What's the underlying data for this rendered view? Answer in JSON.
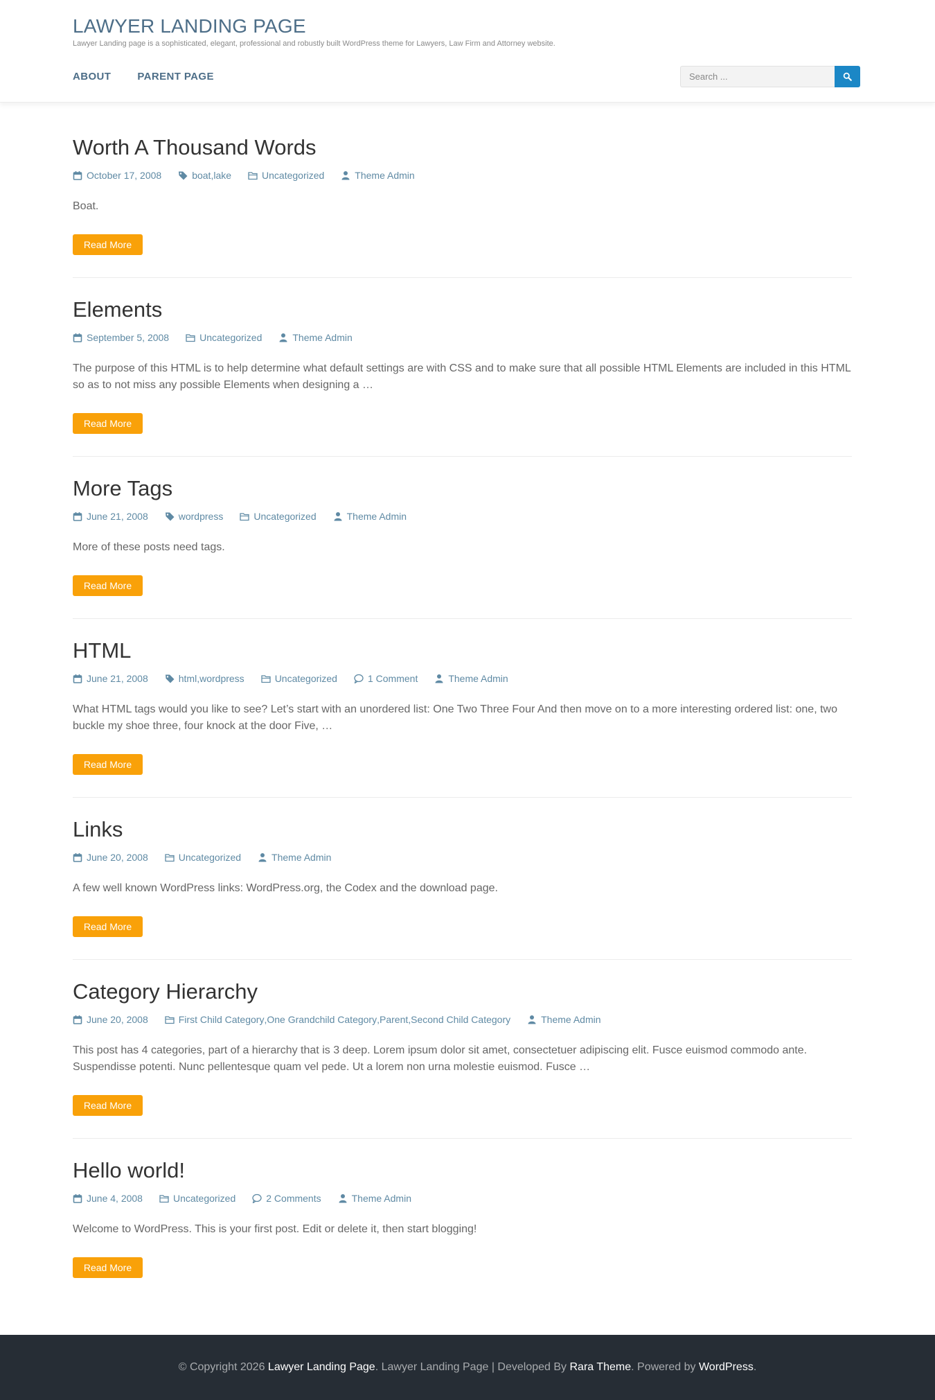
{
  "header": {
    "site_title": "LAWYER LANDING PAGE",
    "tagline": "Lawyer Landing page is a sophisticated, elegant, professional and robustly built WordPress theme for Lawyers, Law Firm and Attorney website.",
    "nav": [
      "ABOUT",
      "PARENT PAGE"
    ],
    "search_placeholder": "Search ..."
  },
  "posts": [
    {
      "title": "Worth A Thousand Words",
      "date": "October 17, 2008",
      "tags": [
        "boat",
        "lake"
      ],
      "categories": [
        "Uncategorized"
      ],
      "comments": "",
      "author": "Theme Admin",
      "excerpt": "Boat.",
      "read_more": "Read More"
    },
    {
      "title": "Elements",
      "date": "September 5, 2008",
      "tags": [],
      "categories": [
        "Uncategorized"
      ],
      "comments": "",
      "author": "Theme Admin",
      "excerpt": "The purpose of this HTML is to help determine what default settings are with CSS and to make sure that all possible HTML Elements are included in this HTML so as to not miss any possible Elements when designing a …",
      "read_more": "Read More"
    },
    {
      "title": "More Tags",
      "date": "June 21, 2008",
      "tags": [
        "wordpress"
      ],
      "categories": [
        "Uncategorized"
      ],
      "comments": "",
      "author": "Theme Admin",
      "excerpt": "More of these posts need tags.",
      "read_more": "Read More"
    },
    {
      "title": "HTML",
      "date": "June 21, 2008",
      "tags": [
        "html",
        "wordpress"
      ],
      "categories": [
        "Uncategorized"
      ],
      "comments": "1 Comment",
      "author": "Theme Admin",
      "excerpt": "What HTML tags would you like to see? Let’s start with an unordered list: One Two Three Four And then move on to a more interesting ordered list: one, two buckle my shoe three, four knock at the door Five, …",
      "read_more": "Read More"
    },
    {
      "title": "Links",
      "date": "June 20, 2008",
      "tags": [],
      "categories": [
        "Uncategorized"
      ],
      "comments": "",
      "author": "Theme Admin",
      "excerpt": "A few well known WordPress links: WordPress.org, the Codex and the download page.",
      "read_more": "Read More"
    },
    {
      "title": "Category Hierarchy",
      "date": "June 20, 2008",
      "tags": [],
      "categories": [
        "First Child Category",
        "One Grandchild Category",
        "Parent",
        "Second Child Category"
      ],
      "comments": "",
      "author": "Theme Admin",
      "excerpt": "This post has 4 categories, part of a hierarchy that is 3 deep. Lorem ipsum dolor sit amet, consectetuer adipiscing elit. Fusce euismod commodo ante. Suspendisse potenti. Nunc pellentesque quam vel pede. Ut a lorem non urna molestie euismod. Fusce …",
      "read_more": "Read More"
    },
    {
      "title": "Hello world!",
      "date": "June 4, 2008",
      "tags": [],
      "categories": [
        "Uncategorized"
      ],
      "comments": "2 Comments",
      "author": "Theme Admin",
      "excerpt": "Welcome to WordPress. This is your first post. Edit or delete it, then start blogging!",
      "read_more": "Read More"
    }
  ],
  "footer": {
    "copyright": "© Copyright 2026",
    "site_link": "Lawyer Landing Page",
    "developed_text": ". Lawyer Landing Page | Developed By",
    "developer_link": "Rara Theme",
    "powered_text": ". Powered by",
    "powered_link": "WordPress",
    "end": "."
  },
  "colors": {
    "accent": "#1b87c6",
    "button": "#f9a109",
    "meta": "#5f8aa4",
    "title": "#4d6e88",
    "footer_bg": "#262d35"
  }
}
